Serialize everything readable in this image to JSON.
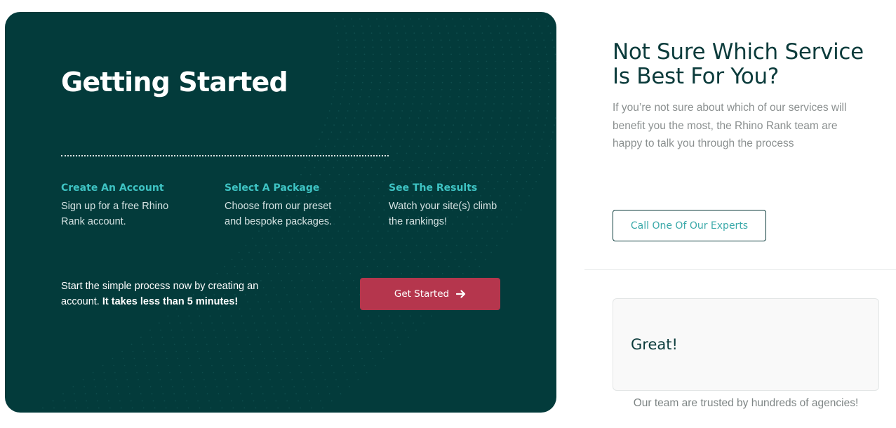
{
  "colors": {
    "card_bg": "#033b3b",
    "accent_teal": "#3ec3c3",
    "button_red": "#b5364d",
    "heading_dark": "#0b3b3b"
  },
  "getting_started": {
    "title": "Getting Started",
    "steps": [
      {
        "title": "Create An Account",
        "desc": "Sign up for a free Rhino Rank account."
      },
      {
        "title": "Select A Package",
        "desc": "Choose from our preset and bespoke packages."
      },
      {
        "title": "See The Results",
        "desc": "Watch your site(s) climb the rankings!"
      }
    ],
    "cta_text": "Start the simple process now by creating an account.",
    "cta_emphasis": "It takes less than 5 minutes!",
    "button_label": "Get Started",
    "button_icon": "arrow-right-icon"
  },
  "sidebar": {
    "heading": "Not Sure Which Service Is Best For You?",
    "description": "If you’re not sure about which of our services will benefit you the most, the Rhino Rank team are happy to talk you through the process",
    "call_button_label": "Call One Of Our Experts",
    "review_word": "Great!",
    "trusted_text": "Our team are trusted by hundreds of agencies!"
  }
}
